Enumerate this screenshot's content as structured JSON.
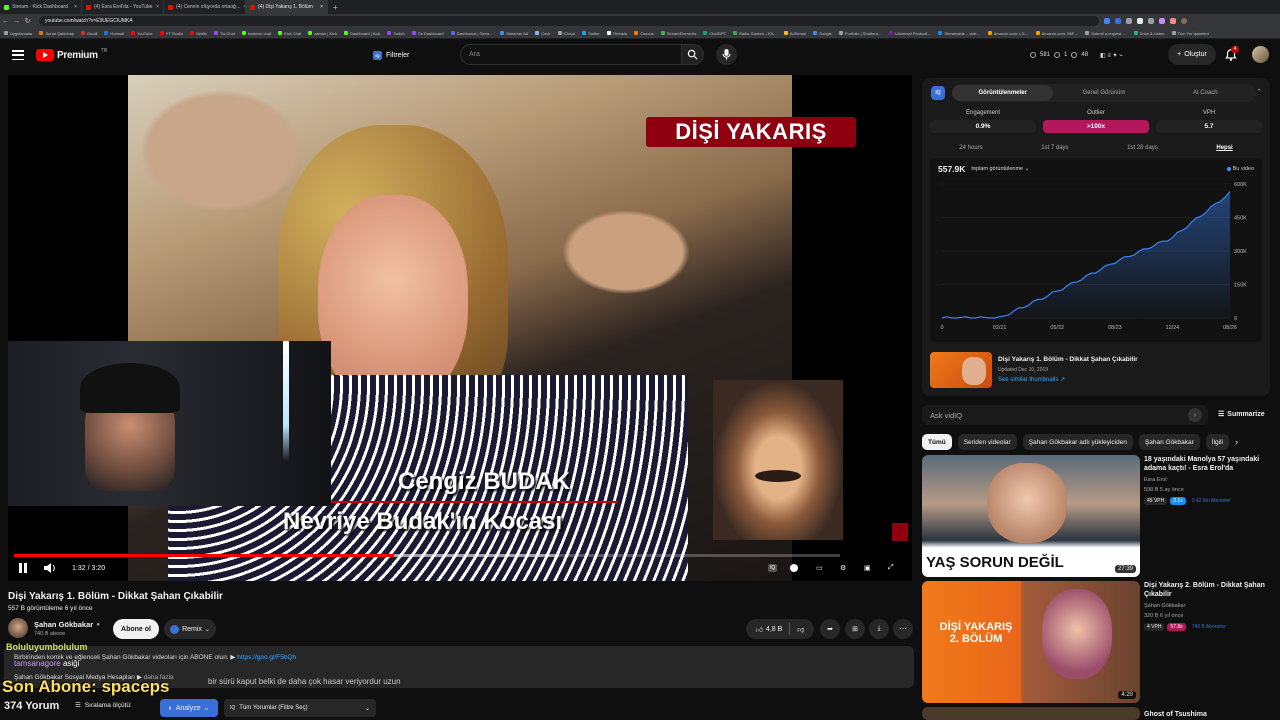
{
  "browser": {
    "tabs": [
      {
        "title": "Stream - Kick Dashboard",
        "color": "#53fc18",
        "active": false
      },
      {
        "title": "(4) Esra Erol'da - YouTube",
        "color": "#ff0000",
        "active": false
      },
      {
        "title": "(4) Cennin ırlüyorda ortaoğ…",
        "color": "#ff0000",
        "active": false
      },
      {
        "title": "(4) Dişi Yakarış 1. Bölüm",
        "color": "#ff0000",
        "active": true
      }
    ],
    "new_tab": "+",
    "url": "youtube.com/watch?v=E9UEGCIUMKA",
    "bookmarks": [
      "Uygulamalar",
      "Sunar Şahinbaş",
      "Gmail",
      "Hotmail",
      "YouTube",
      "YT Studio",
      "Netflix",
      "Tw Chat",
      "keskinin chat",
      "Kick Chat",
      "zaman | Kick",
      "Dashboard | Kick",
      "Twitch",
      "Tw Dashboard",
      "Dashboard | Strea…",
      "Streamer Ad",
      "Çevir",
      "iCloud",
      "Twitter",
      "Threads",
      "Ozzcus",
      "StreamElements",
      "ChatGPT",
      "Radio Garden – Kli…",
      "AdSense",
      "Google",
      "Portfolio | Shuttera…",
      "Universal Producti…",
      "Streamable – vide…",
      "Amazon.com: LG…",
      "Amazon.com: WiF…",
      "Submit a request …",
      "Drive & Listen",
      "Tüm Yer İşaretleri"
    ]
  },
  "youtube": {
    "logo_text": "Premium",
    "logo_sup": "TR",
    "filters_label": "Filtreler",
    "search_placeholder": "Ara",
    "stats": {
      "subs": "581",
      "a": "1",
      "b": "48"
    },
    "create_label": "Oluştur",
    "notif_count": "4"
  },
  "player": {
    "overlay_title": "DİŞİ YAKARIŞ",
    "caption_line1": "Cengiz BUDAK",
    "caption_line2": "Nevriye Budak'ın Kocası",
    "time": "1:32 / 3:20",
    "progress": 0.46,
    "buffered": 0.2,
    "corner_logo": "DİŞİ YAKARIŞ"
  },
  "video": {
    "title": "Dişi Yakarış 1. Bölüm - Dikkat Şahan Çıkabilir",
    "meta": "557 B görüntüleme  6 yıl önce",
    "channel": "Şahan Gökbakar",
    "subs": "740 B abone",
    "subscribe": "Abone ol",
    "remix": "Remix",
    "likes": "4,8 B"
  },
  "overlay_chat": {
    "user1": "Boluluyumbolulum",
    "user2": "tamsanagore",
    "msg2": "asiği",
    "big": "Son Abone: spaceps",
    "garbled": "bir sürü kaput belki de daha çok hasar veriyordur uzun"
  },
  "description": {
    "line1": "Birbirinden komik ve eğlenceli Şahan Gökbakar videoları için ABONE olun. ▶",
    "link": "https://goo.gl/F5bQh",
    "line2": "Şahan Gökbakar Sosyal Medya Hesapları ▶",
    "more": "daha fazla"
  },
  "comments": {
    "count": "374 Yorum",
    "sort": "Sıralama ölçütü:",
    "analyze": "Analyze",
    "filter": "Tüm Yorumlar (Filtre Seç)"
  },
  "vidiq": {
    "tabs": [
      "Görüntülenmeler",
      "Genel Görünüm",
      "AI Coach"
    ],
    "metrics": [
      {
        "label": "Engagement",
        "value": "0.9%",
        "hot": false
      },
      {
        "label": "Outlier",
        "value": ">100x",
        "hot": true
      },
      {
        "label": "VPH",
        "value": "5.7",
        "hot": false
      }
    ],
    "ranges": [
      "24 hours",
      "1st 7 days",
      "1st 28 days",
      "Hepsi"
    ],
    "total": "557.9K",
    "total_label": "toplam görüntülenme",
    "legend": "Bu video",
    "card_title": "Dişi Yakarış 1. Bölüm - Dikkat Şahan Çıkabilir",
    "card_updated": "Updated Dec 10, 2019",
    "card_link": "See similar thumbnails ↗",
    "ask": "Ask vidIQ",
    "summarize": "Summarize"
  },
  "chart_data": {
    "type": "area",
    "x": [
      "02/21",
      "05/22",
      "08/23",
      "12/24",
      "08/26"
    ],
    "series": [
      {
        "values": [
          0,
          120,
          250,
          360,
          560
        ]
      }
    ],
    "y_ticks": [
      "0",
      "150K",
      "300K",
      "450K",
      "600K"
    ],
    "x_ticks": [
      "0",
      "02/21",
      "05/22",
      "08/23",
      "12/24",
      "08/26"
    ],
    "ylim": [
      0,
      600
    ],
    "color": "#3b82f6"
  },
  "chips": [
    "Tümü",
    "Seriden videolar",
    "Şahan Gökbakar adlı yükleyiciden",
    "Şahan Gökbakar",
    "İlgili"
  ],
  "recommendations": [
    {
      "title": "18 yaşındaki Manolya 57 yaşındaki adama kaçtı! - Esra Erol'da",
      "channel": "Esra Erol",
      "meta": "598 B  5 ay önce",
      "duration": "27:39",
      "thumb_text": "YAŞ SORUN DEĞİL",
      "tags": [
        "45 VPH",
        "3.1x",
        "2.42 Mn Aboneler"
      ]
    },
    {
      "title": "Dişi Yakarış 2. Bölüm - Dikkat Şahan Çıkabilir",
      "channel": "Şahan Gökbakar",
      "meta": "320 B  6 yıl önce",
      "duration": "4:20",
      "thumb_text": "DİŞİ YAKARIŞ 2. BÖLÜM",
      "tags": [
        "4 VPH",
        "57.8x",
        "740 B Aboneler"
      ]
    },
    {
      "title": "Ghost of Tsushima",
      "channel": "",
      "meta": "",
      "duration": "",
      "thumb_text": "",
      "tags": []
    }
  ]
}
